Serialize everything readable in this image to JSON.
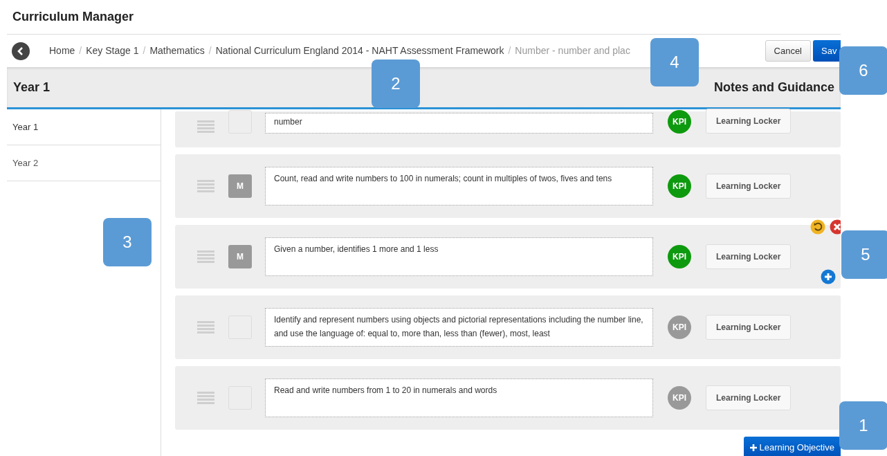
{
  "app_title": "Curriculum Manager",
  "breadcrumb_separator": "/",
  "breadcrumb": [
    {
      "label": "Home",
      "current": false
    },
    {
      "label": "Key Stage 1",
      "current": false
    },
    {
      "label": "Mathematics",
      "current": false
    },
    {
      "label": "National Curriculum England 2014 - NAHT Assessment Framework",
      "current": false
    },
    {
      "label": "Number - number and plac",
      "current": true
    }
  ],
  "actions": {
    "cancel": "Cancel",
    "save": "Sav"
  },
  "header": {
    "left": "Year 1",
    "right": "Notes and Guidance"
  },
  "sidebar": {
    "items": [
      {
        "label": "Year 1",
        "selected": true
      },
      {
        "label": "Year 2",
        "selected": false
      }
    ]
  },
  "objectives": [
    {
      "text": "number",
      "marked": false,
      "kpi": "KPI",
      "kpi_on": true,
      "locker": "Learning Locker",
      "show_actions": false,
      "partial": true
    },
    {
      "text": "Count, read and write numbers to 100 in numerals; count in multiples of twos, fives and tens",
      "marked": true,
      "badge": "M",
      "kpi": "KPI",
      "kpi_on": true,
      "locker": "Learning Locker",
      "show_actions": false,
      "partial": false
    },
    {
      "text": "Given a number, identifies 1 more and 1 less",
      "marked": true,
      "badge": "M",
      "kpi": "KPI",
      "kpi_on": true,
      "locker": "Learning Locker",
      "show_actions": true,
      "partial": false
    },
    {
      "text": "Identify and represent numbers using objects and pictorial representations including the number line, and use the language of: equal to, more than, less than (fewer), most, least",
      "marked": false,
      "kpi": "KPI",
      "kpi_on": false,
      "locker": "Learning Locker",
      "show_actions": false,
      "partial": false
    },
    {
      "text": "Read and write numbers from 1 to 20 in numerals and words",
      "marked": false,
      "kpi": "KPI",
      "kpi_on": false,
      "locker": "Learning Locker",
      "show_actions": false,
      "partial": false
    }
  ],
  "add_button": "Learning Objective",
  "callouts": [
    "2",
    "4",
    "6",
    "3",
    "5",
    "1"
  ]
}
